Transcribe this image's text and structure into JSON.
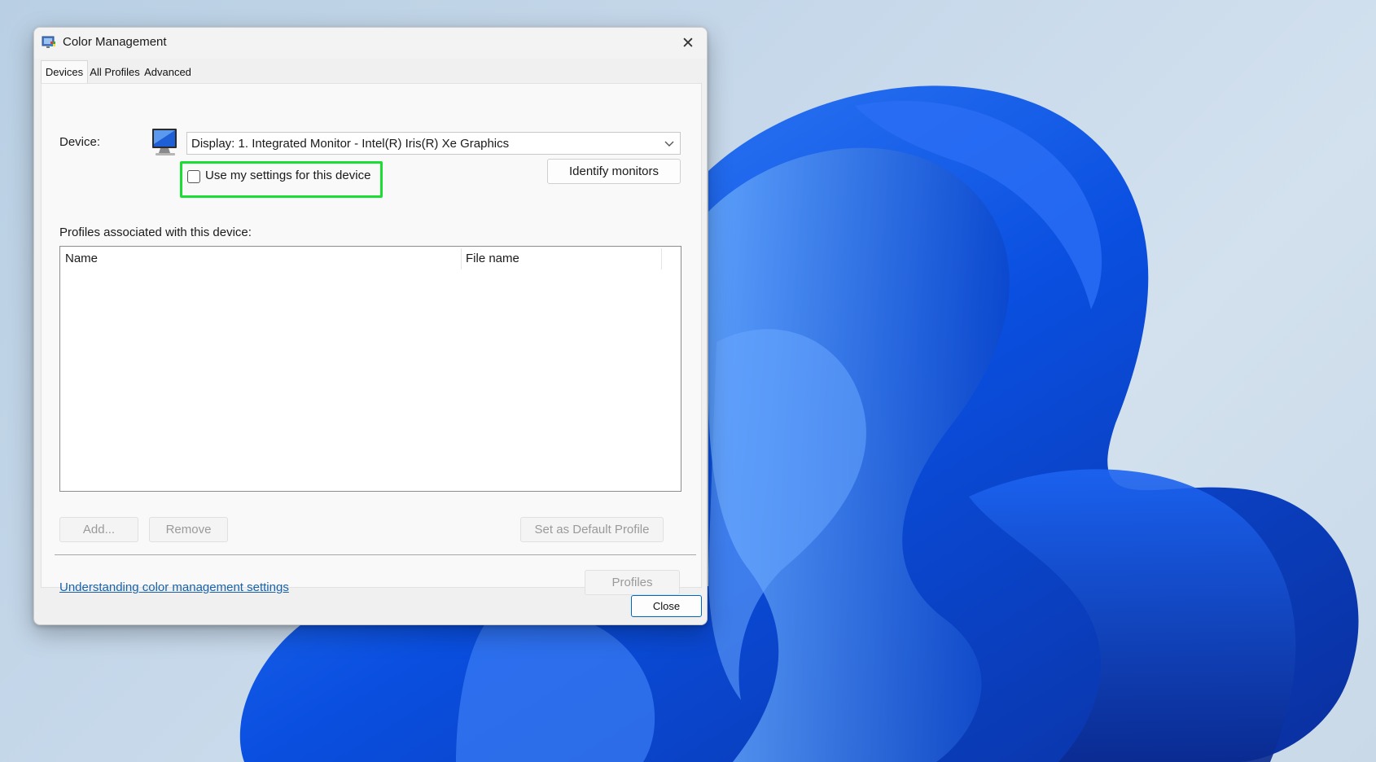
{
  "window": {
    "title": "Color Management",
    "close_glyph": "✕"
  },
  "tabs": [
    {
      "label": "Devices",
      "active": true
    },
    {
      "label": "All Profiles",
      "active": false
    },
    {
      "label": "Advanced",
      "active": false
    }
  ],
  "devices": {
    "device_label": "Device:",
    "device_value": "Display: 1. Integrated Monitor - Intel(R) Iris(R) Xe Graphics",
    "use_settings_label": "Use my settings for this device",
    "use_settings_checked": false,
    "identify_button": "Identify monitors",
    "profiles_label": "Profiles associated with this device:",
    "columns": [
      "Name",
      "File name"
    ],
    "rows": [],
    "add_button": "Add...",
    "remove_button": "Remove",
    "set_default_button": "Set as Default Profile",
    "help_link": "Understanding color management settings",
    "profiles_button": "Profiles"
  },
  "footer": {
    "close_button": "Close"
  },
  "colors": {
    "highlight": "#1bdd34",
    "accent": "#0067c0",
    "link": "#1a62a8"
  }
}
